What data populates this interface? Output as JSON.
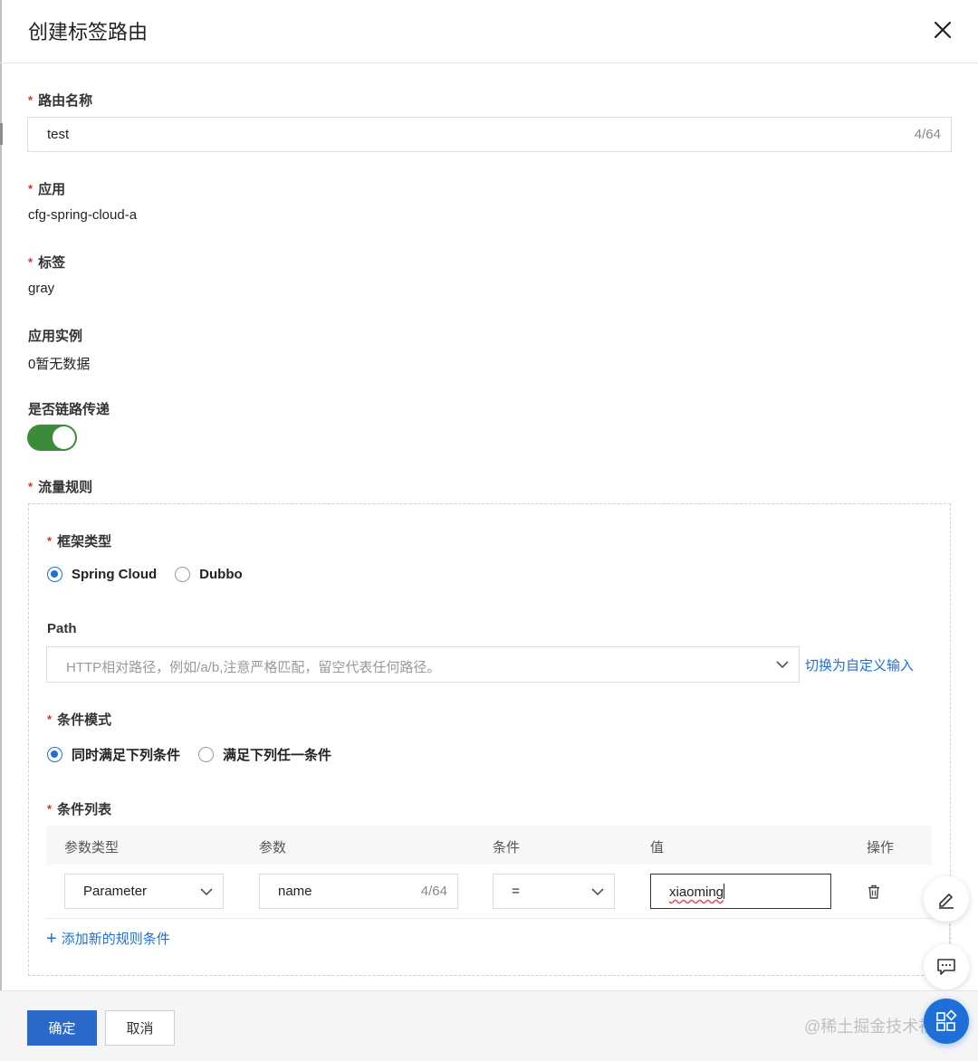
{
  "dialog": {
    "title": "创建标签路由",
    "close_icon": "close-icon"
  },
  "required_mark": "*",
  "form": {
    "route_name": {
      "label": "路由名称",
      "value": "test",
      "counter": "4/64"
    },
    "application": {
      "label": "应用",
      "value": "cfg-spring-cloud-a"
    },
    "tag": {
      "label": "标签",
      "value": "gray"
    },
    "instances": {
      "label": "应用实例",
      "value": "0暂无数据"
    },
    "chain_pass": {
      "label": "是否链路传递",
      "enabled": true,
      "on_color": "#3b8b3b"
    },
    "traffic_rules": {
      "label": "流量规则",
      "framework": {
        "label": "框架类型",
        "options": [
          "Spring Cloud",
          "Dubbo"
        ],
        "selected": "Spring Cloud"
      },
      "path": {
        "label": "Path",
        "placeholder": "HTTP相对路径，例如/a/b,注意严格匹配，留空代表任何路径。",
        "switch_link": "切换为自定义输入"
      },
      "condition_mode": {
        "label": "条件模式",
        "options": [
          "同时满足下列条件",
          "满足下列任一条件"
        ],
        "selected": "同时满足下列条件"
      },
      "condition_list": {
        "label": "条件列表",
        "columns": [
          "参数类型",
          "参数",
          "条件",
          "值",
          "操作"
        ],
        "rows": [
          {
            "param_type": "Parameter",
            "param": "name",
            "param_counter": "4/64",
            "operator": "=",
            "value": "xiaoming",
            "action_icon": "trash-icon"
          }
        ],
        "add_link": "添加新的规则条件",
        "add_icon": "+"
      }
    }
  },
  "footer": {
    "confirm": "确定",
    "cancel": "取消"
  },
  "watermark": "@稀土掘金技术社区",
  "colors": {
    "primary": "#2a68c9",
    "link": "#1f6fd9",
    "required": "#d93026"
  }
}
